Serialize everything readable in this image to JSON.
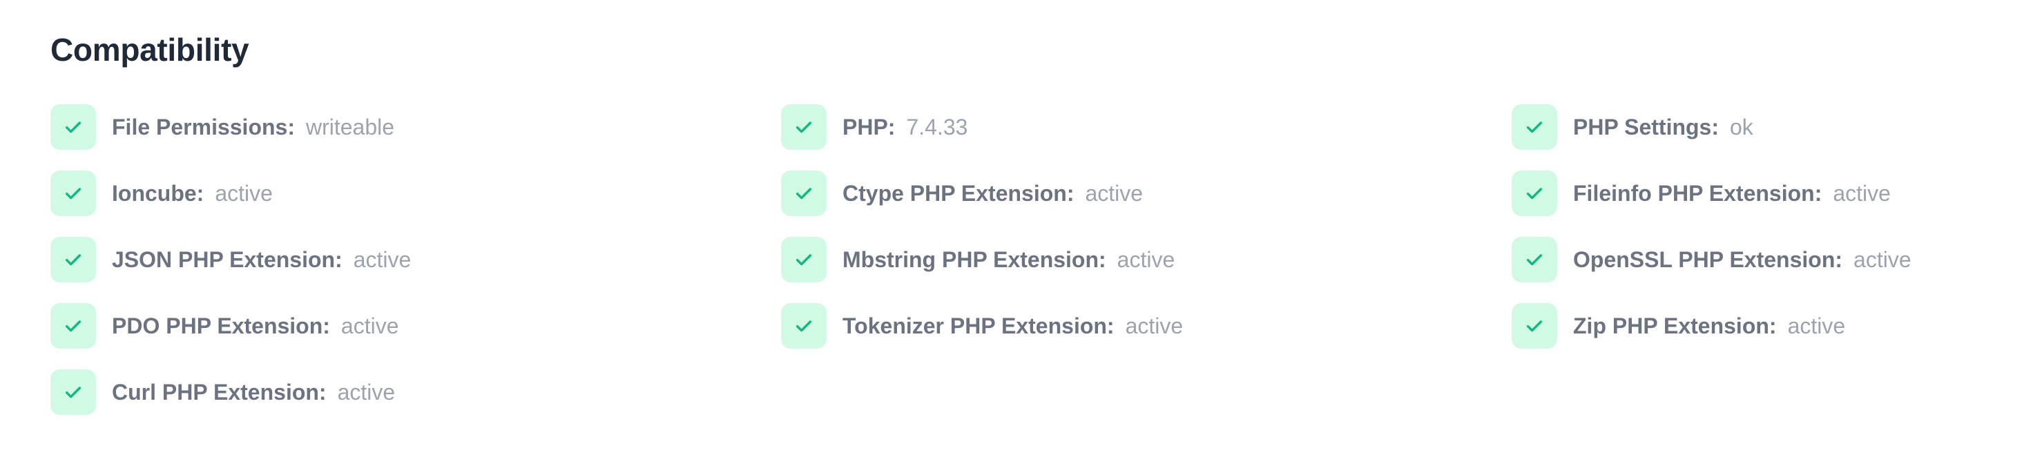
{
  "heading": "Compatibility",
  "checks": [
    {
      "label": "File Permissions:",
      "value": "writeable"
    },
    {
      "label": "PHP:",
      "value": "7.4.33"
    },
    {
      "label": "PHP Settings:",
      "value": "ok"
    },
    {
      "label": "Ioncube:",
      "value": "active"
    },
    {
      "label": "Ctype PHP Extension:",
      "value": "active"
    },
    {
      "label": "Fileinfo PHP Extension:",
      "value": "active"
    },
    {
      "label": "JSON PHP Extension:",
      "value": "active"
    },
    {
      "label": "Mbstring PHP Extension:",
      "value": "active"
    },
    {
      "label": "OpenSSL PHP Extension:",
      "value": "active"
    },
    {
      "label": "PDO PHP Extension:",
      "value": "active"
    },
    {
      "label": "Tokenizer PHP Extension:",
      "value": "active"
    },
    {
      "label": "Zip PHP Extension:",
      "value": "active"
    },
    {
      "label": "Curl PHP Extension:",
      "value": "active"
    }
  ],
  "icon": "check-icon",
  "colors": {
    "success_bg": "#d1fae5",
    "success_icon": "#10b981",
    "heading_text": "#1f2937",
    "label_text": "#6b7280",
    "value_text": "#9ca3af"
  }
}
